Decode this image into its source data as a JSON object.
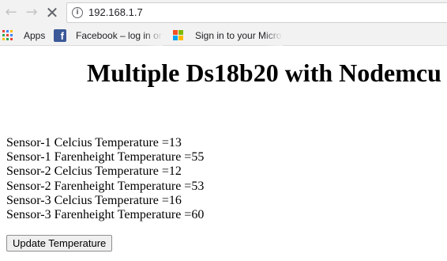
{
  "browser": {
    "url": "192.168.1.7",
    "bookmarks": {
      "apps_label": "Apps",
      "facebook_label": "Facebook – log in or",
      "microsoft_label": "Sign in to your Micro"
    }
  },
  "page": {
    "title": "Multiple Ds18b20 with Nodemcu",
    "readings": [
      "Sensor-1 Celcius Temperature =13",
      "Sensor-1 Farenheight Temperature =55",
      "Sensor-2 Celcius Temperature =12",
      "Sensor-2 Farenheight Temperature =53",
      "Sensor-3 Celcius Temperature =16",
      "Sensor-3 Farenheight Temperature =60"
    ],
    "button_label": "Update Temperature"
  }
}
